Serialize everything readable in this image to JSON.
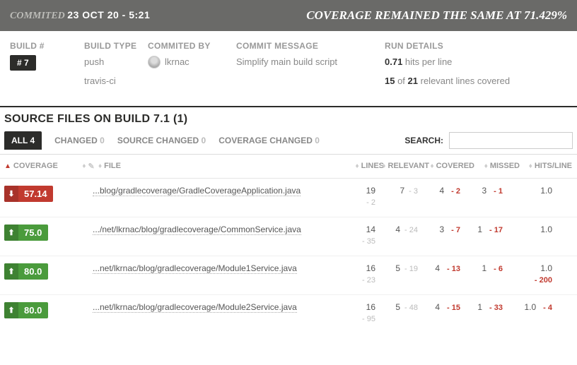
{
  "header": {
    "committed_label": "COMMITED",
    "date": "23 OCT 20 - 5:21",
    "status": "COVERAGE REMAINED THE SAME AT 71.429%"
  },
  "meta": {
    "build_label": "BUILD #",
    "build_num": "# 7",
    "type_label": "BUILD TYPE",
    "type1": "push",
    "type2": "travis-ci",
    "author_label": "COMMITED BY",
    "author": "lkrnac",
    "msg_label": "COMMIT MESSAGE",
    "msg": "Simplify main build script",
    "run_label": "RUN DETAILS",
    "run1_b": "0.71",
    "run1_rest": " hits per line",
    "run2_b1": "15",
    "run2_mid": " of ",
    "run2_b2": "21",
    "run2_rest": " relevant lines covered"
  },
  "section_title": "SOURCE FILES ON BUILD 7.1 (1)",
  "tabs": {
    "all": "ALL",
    "all_cnt": "4",
    "changed": "CHANGED",
    "changed_cnt": "0",
    "srcchanged": "SOURCE CHANGED",
    "srcchanged_cnt": "0",
    "covchanged": "COVERAGE CHANGED",
    "covchanged_cnt": "0"
  },
  "search": {
    "label": "SEARCH:",
    "placeholder": ""
  },
  "cols": {
    "coverage": "COVERAGE",
    "file": "FILE",
    "lines": "LINES",
    "relevant": "RELEVANT",
    "covered": "COVERED",
    "missed": "MISSED",
    "hits": "HITS/LINE"
  },
  "rows": [
    {
      "dir": "down",
      "color": "red",
      "cov": "57.14",
      "file": "...blog/gradlecoverage/GradleCoverageApplication.java",
      "lines": "19",
      "lines_sub": "- 2",
      "relevant": "7",
      "relevant_diff": "- 3",
      "covered": "4",
      "covered_diff": "- 2",
      "missed": "3",
      "missed_diff": "- 1",
      "hits": "1.0",
      "hits_diff": ""
    },
    {
      "dir": "up",
      "color": "green",
      "cov": "75.0",
      "file": ".../net/lkrnac/blog/gradlecoverage/CommonService.java",
      "lines": "14",
      "lines_sub": "- 35",
      "relevant": "4",
      "relevant_diff": "- 24",
      "covered": "3",
      "covered_diff": "- 7",
      "missed": "1",
      "missed_diff": "- 17",
      "hits": "1.0",
      "hits_diff": ""
    },
    {
      "dir": "up",
      "color": "green",
      "cov": "80.0",
      "file": "...net/lkrnac/blog/gradlecoverage/Module1Service.java",
      "lines": "16",
      "lines_sub": "- 23",
      "relevant": "5",
      "relevant_diff": "- 19",
      "covered": "4",
      "covered_diff": "- 13",
      "missed": "1",
      "missed_diff": "- 6",
      "hits": "1.0",
      "hits_diff": "- 200"
    },
    {
      "dir": "up",
      "color": "green",
      "cov": "80.0",
      "file": "...net/lkrnac/blog/gradlecoverage/Module2Service.java",
      "lines": "16",
      "lines_sub": "- 95",
      "relevant": "5",
      "relevant_diff": "- 48",
      "covered": "4",
      "covered_diff": "- 15",
      "missed": "1",
      "missed_diff": "- 33",
      "hits": "1.0",
      "hits_diff": "- 4"
    }
  ]
}
